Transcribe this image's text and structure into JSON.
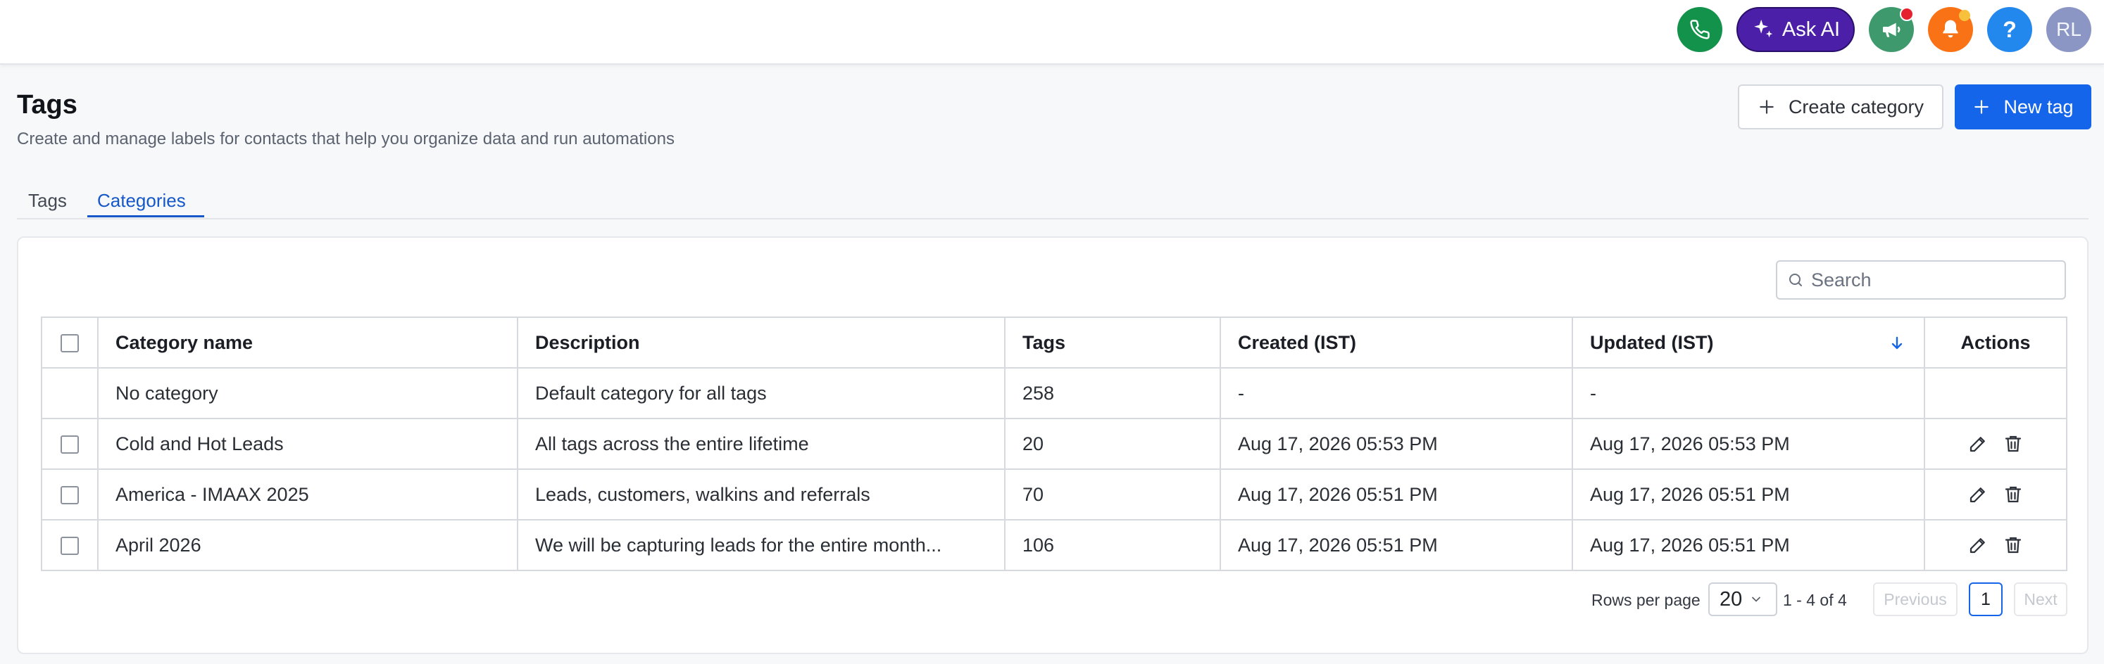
{
  "topbar": {
    "ask_ai_label": "Ask AI",
    "help_glyph": "?",
    "avatar_initials": "RL"
  },
  "header": {
    "title": "Tags",
    "subtitle": "Create and manage labels for contacts that help you organize data and run automations",
    "create_category_label": "Create category",
    "new_tag_label": "New tag"
  },
  "tabs": [
    {
      "label": "Tags",
      "active": false
    },
    {
      "label": "Categories",
      "active": true
    }
  ],
  "search": {
    "placeholder": "Search"
  },
  "table": {
    "columns": [
      "Category name",
      "Description",
      "Tags",
      "Created (IST)",
      "Updated (IST)",
      "Actions"
    ],
    "rows": [
      {
        "name": "No category",
        "description": "Default category for all tags",
        "tags": "258",
        "created": "-",
        "updated": "-"
      },
      {
        "name": "Cold and Hot Leads",
        "description": "All tags across the entire lifetime",
        "tags": "20",
        "created": "Aug 17, 2026 05:53 PM",
        "updated": "Aug 17, 2026 05:53 PM"
      },
      {
        "name": "America - IMAAX 2025",
        "description": "Leads, customers, walkins and referrals",
        "tags": "70",
        "created": "Aug 17, 2026 05:51 PM",
        "updated": "Aug 17, 2026 05:51 PM"
      },
      {
        "name": "April 2026",
        "description": "We will be capturing leads for the entire month...",
        "tags": "106",
        "created": "Aug 17, 2026 05:51 PM",
        "updated": "Aug 17, 2026 05:51 PM"
      }
    ]
  },
  "pagination": {
    "rows_per_page_label": "Rows per page",
    "rows_per_page_value": "20",
    "range": "1 - 4 of 4",
    "previous_label": "Previous",
    "current_page": "1",
    "next_label": "Next"
  },
  "colors": {
    "primary": "#1565ea",
    "ask_ai": "#4b1fa8",
    "phone": "#12924a",
    "announce": "#3e9a6d",
    "bell": "#f97316",
    "help": "#2388ee",
    "avatar": "#8b96c5"
  },
  "icons": [
    "phone-icon",
    "sparkle-icon",
    "megaphone-icon",
    "bell-icon",
    "plus-icon",
    "search-icon",
    "arrow-down-icon",
    "pencil-icon",
    "trash-icon",
    "chevron-down-icon"
  ]
}
